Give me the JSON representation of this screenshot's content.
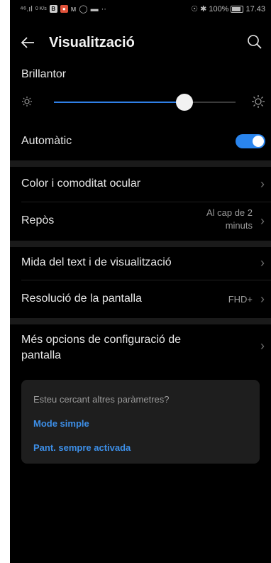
{
  "status_bar": {
    "signal": "⁴⁶.ıl",
    "net_speed": "0 K/s",
    "app_icons": [
      "B",
      "M"
    ],
    "battery": "100%",
    "time": "17.43"
  },
  "app_bar": {
    "title": "Visualització"
  },
  "brightness": {
    "label": "Brillantor",
    "level_percent": 72
  },
  "automatic": {
    "label": "Automàtic",
    "enabled": true
  },
  "items": {
    "color_comfort": {
      "label": "Color i comoditat ocular"
    },
    "sleep": {
      "label": "Repòs",
      "value_line1": "Al cap de 2",
      "value_line2": "minuts"
    },
    "text_size": {
      "label": "Mida del text i de visualització"
    },
    "resolution": {
      "label": "Resolució de la pantalla",
      "value": "FHD+"
    },
    "more_options": {
      "label_line1": "Més opcions de configuració de",
      "label_line2": "pantalla"
    }
  },
  "suggestions": {
    "title": "Esteu cercant altres paràmetres?",
    "link1": "Mode simple",
    "link2": "Pant. sempre activada"
  },
  "colors": {
    "accent": "#2a85ee",
    "link": "#3d8fe8",
    "background": "#000000"
  }
}
